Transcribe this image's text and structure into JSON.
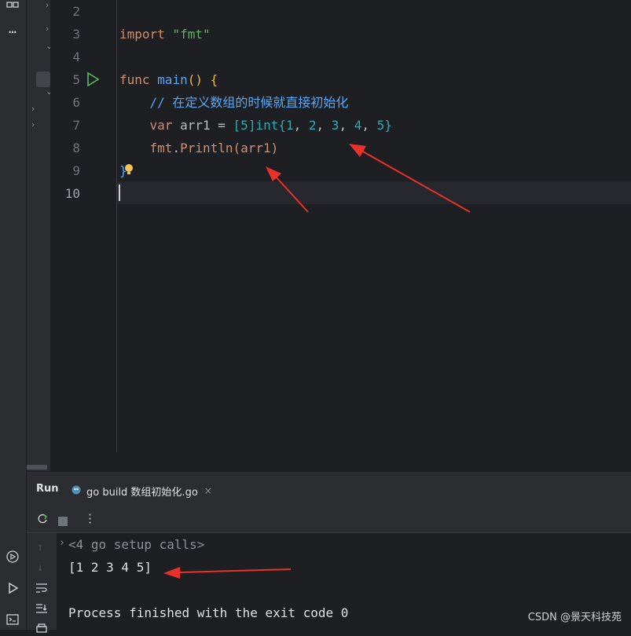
{
  "editor": {
    "lines": [
      {
        "no": "2"
      },
      {
        "no": "3"
      },
      {
        "no": "4"
      },
      {
        "no": "5"
      },
      {
        "no": "6"
      },
      {
        "no": "7"
      },
      {
        "no": "8"
      },
      {
        "no": "9"
      },
      {
        "no": "10"
      }
    ],
    "code": {
      "l3_kw": "import",
      "l3_str": "\"fmt\"",
      "l5_kw": "func",
      "l5_fn": "main",
      "l5_paren": "()",
      "l5_brace": "{",
      "l6_cmt": "// 在定义数组的时候就直接初始化",
      "l7_kw": "var",
      "l7_ident": "arr1",
      "l7_eq": "=",
      "l7_type_open": "[",
      "l7_len": "5",
      "l7_type_close": "]int{",
      "l7_vals": [
        "1",
        "2",
        "3",
        "4",
        "5"
      ],
      "l7_close": "}",
      "l8_pkg": "fmt",
      "l8_fn": "Println",
      "l8_args": "(arr1)",
      "l9_brace": "}"
    }
  },
  "run": {
    "title": "Run",
    "tab_label": "go build 数组初始化.go",
    "tab_close": "×",
    "console": [
      "<4 go setup calls>",
      "[1 2 3 4 5]",
      "Process finished with the exit code 0"
    ]
  },
  "watermark": "CSDN @景天科技苑",
  "colors": {
    "accent": "#3574f0",
    "arrow": "#e8312b"
  }
}
